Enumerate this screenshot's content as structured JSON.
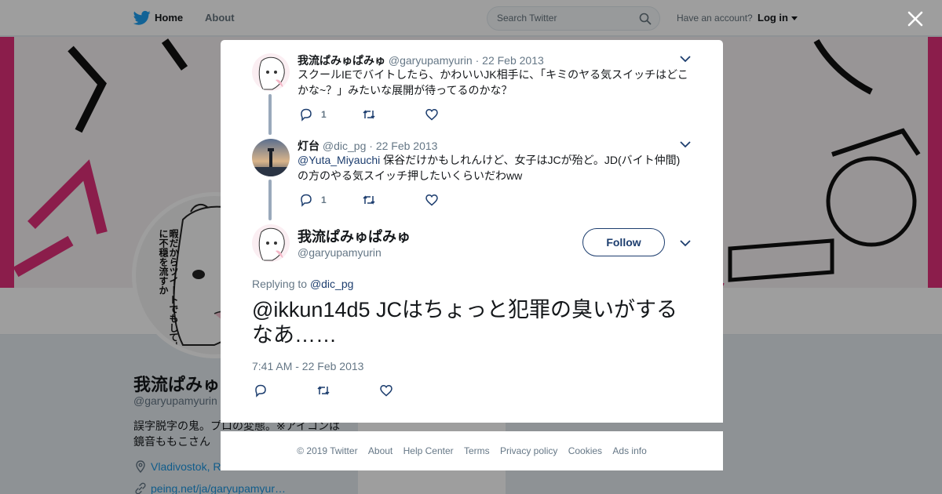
{
  "topbar": {
    "bird_icon": "twitter-bird-icon",
    "home_label": "Home",
    "about_label": "About",
    "search_placeholder": "Search Twitter",
    "have_account": "Have an account?",
    "login_label": "Log in"
  },
  "profile": {
    "name": "我流ぱみゅぱみゅ",
    "handle": "@garyupamyurin",
    "bio": "誤字脱字の鬼。プロの変態。※アイコンは鏡音ももこさん",
    "location": "Vladivostok, R",
    "link": "peing.net/ja/garyupamyur…",
    "avatar_text": "暇だからツイートでもしてTLに不穏を流すか"
  },
  "tweets": [
    {
      "name": "我流ぱみゅぱみゅ",
      "handle": "@garyupamyurin",
      "dot": "·",
      "date": "22 Feb 2013",
      "text": "スクールIEでバイトしたら、かわいいJK相手に、「キミのヤる気スイッチはどこかな~？」みたいな展開が待ってるのかな？",
      "reply_count": "1"
    },
    {
      "name": "灯台",
      "handle": "@dic_pg",
      "dot": "·",
      "date": "22 Feb 2013",
      "mention": "@Yuta_Miyauchi",
      "text": " 保谷だけかもしれんけど、女子はJCが殆ど。JD(バイト仲間)の方のやる気スイッチ押したいくらいだわww",
      "reply_count": "1"
    }
  ],
  "main_tweet": {
    "name": "我流ぱみゅぱみゅ",
    "handle": "@garyupamyurin",
    "follow_label": "Follow",
    "replying_label": "Replying to ",
    "replying_mention": "@dic_pg",
    "text": "@ikkun14d5 JCはちょっと犯罪の臭いがするなあ……",
    "timestamp": "7:41 AM - 22 Feb 2013"
  },
  "footer": {
    "copyright": "© 2019 Twitter",
    "links": [
      "About",
      "Help Center",
      "Terms",
      "Privacy policy",
      "Cookies",
      "Ads info"
    ]
  },
  "colors": {
    "twitter_blue": "#1da1f2",
    "accent_navy": "#1c3d6e",
    "banner_pink": "#e0307a"
  }
}
